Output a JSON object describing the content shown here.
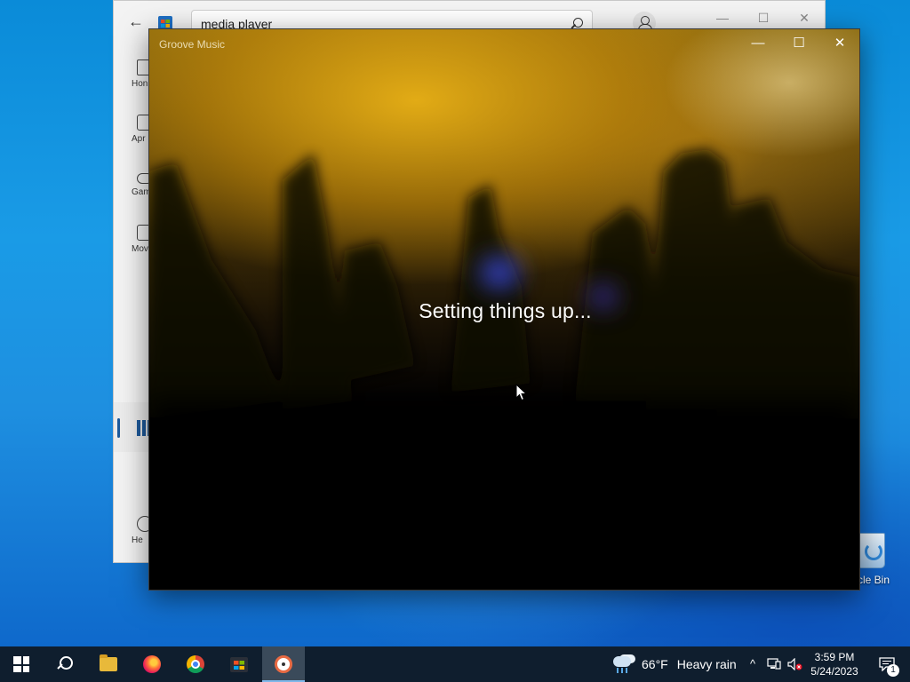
{
  "desktop": {
    "recycle_bin_label": "ycle Bin"
  },
  "store_window": {
    "search_value": "media player",
    "nav": {
      "home": "Hon",
      "apps": "Apr",
      "gaming": "Gam",
      "movies": "Movies",
      "help": "He"
    }
  },
  "groove_window": {
    "title": "Groove Music",
    "status_text": "Setting things up..."
  },
  "window_controls": {
    "minimize": "—",
    "maximize": "☐",
    "close": "✕"
  },
  "taskbar": {
    "apps": [
      {
        "name": "start",
        "icon": "windows-logo-icon"
      },
      {
        "name": "search",
        "icon": "search-icon"
      },
      {
        "name": "file-explorer",
        "icon": "folder-icon"
      },
      {
        "name": "firefox",
        "icon": "firefox-icon"
      },
      {
        "name": "chrome",
        "icon": "chrome-icon"
      },
      {
        "name": "microsoft-store",
        "icon": "store-icon"
      },
      {
        "name": "groove-music",
        "icon": "groove-icon",
        "active": true
      }
    ],
    "weather": {
      "temperature": "66°F",
      "condition": "Heavy rain",
      "icon": "rain-cloud-icon"
    },
    "tray": {
      "chevron": "^",
      "network_icon": "network-icon",
      "volume_icon": "volume-muted-icon",
      "time": "3:59 PM",
      "date": "5/24/2023",
      "notification_count": "1"
    }
  },
  "colors": {
    "accent": "#1e5a9c",
    "taskbar": "#0f1e2e",
    "desktop": "#1a9be6"
  }
}
